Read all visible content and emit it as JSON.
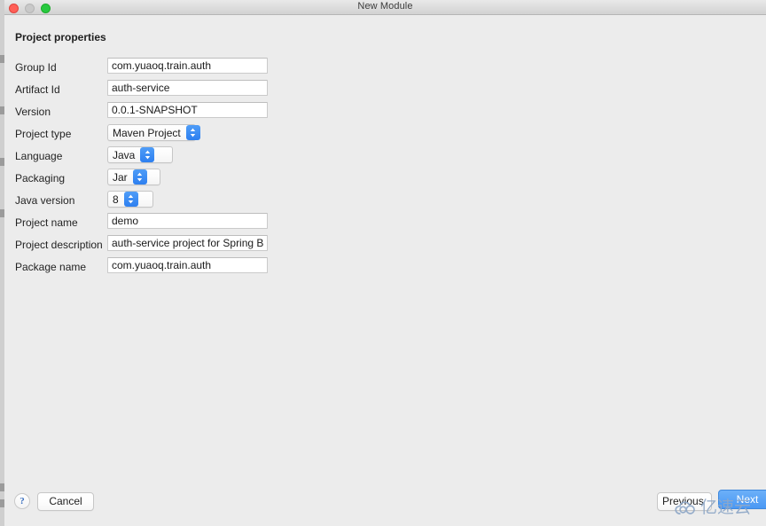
{
  "window": {
    "title": "New Module",
    "traffic_lights": [
      "close",
      "minimize",
      "zoom"
    ]
  },
  "section": {
    "title": "Project properties"
  },
  "form": {
    "rows": [
      {
        "label": "Group Id",
        "type": "text",
        "value": "com.yuaoq.train.auth"
      },
      {
        "label": "Artifact Id",
        "type": "text",
        "value": "auth-service"
      },
      {
        "label": "Version",
        "type": "text",
        "value": "0.0.1-SNAPSHOT"
      },
      {
        "label": "Project type",
        "type": "popup",
        "value": "Maven Project"
      },
      {
        "label": "Language",
        "type": "popup",
        "value": "Java"
      },
      {
        "label": "Packaging",
        "type": "popup",
        "value": "Jar"
      },
      {
        "label": "Java version",
        "type": "popup",
        "value": "8"
      },
      {
        "label": "Project name",
        "type": "text",
        "value": "demo"
      },
      {
        "label": "Project description",
        "type": "text",
        "value": "auth-service project for Spring Boot"
      },
      {
        "label": "Package name",
        "type": "text",
        "value": "com.yuaoq.train.auth"
      }
    ]
  },
  "footer": {
    "help_label": "?",
    "cancel_label": "Cancel",
    "previous_label": "Previous",
    "next_label": "Next"
  },
  "watermark": {
    "text": "亿速云",
    "icon": "cloud-icon",
    "color": "#8fa8c8"
  },
  "colors": {
    "accent": "#2d7ff0",
    "window_bg": "#ececec",
    "titlebar_bg": "#dcdcdc",
    "field_bg": "#ffffff",
    "field_border": "#cacaca",
    "text": "#232323"
  }
}
